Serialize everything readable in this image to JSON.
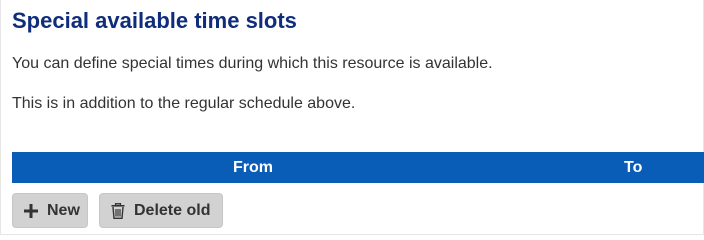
{
  "section": {
    "title": "Special available time slots",
    "description": "You can define special times during which this resource is available.",
    "note": "This is in addition to the regular schedule above."
  },
  "table": {
    "columns": [
      "From",
      "To"
    ],
    "header_color": "#0a5db7"
  },
  "actions": {
    "new_label": "New",
    "new_icon": "plus-icon",
    "delete_label": "Delete old",
    "delete_icon": "trash-icon"
  },
  "colors": {
    "title": "#0f2d7a",
    "button_bg": "#d2d2d2"
  }
}
